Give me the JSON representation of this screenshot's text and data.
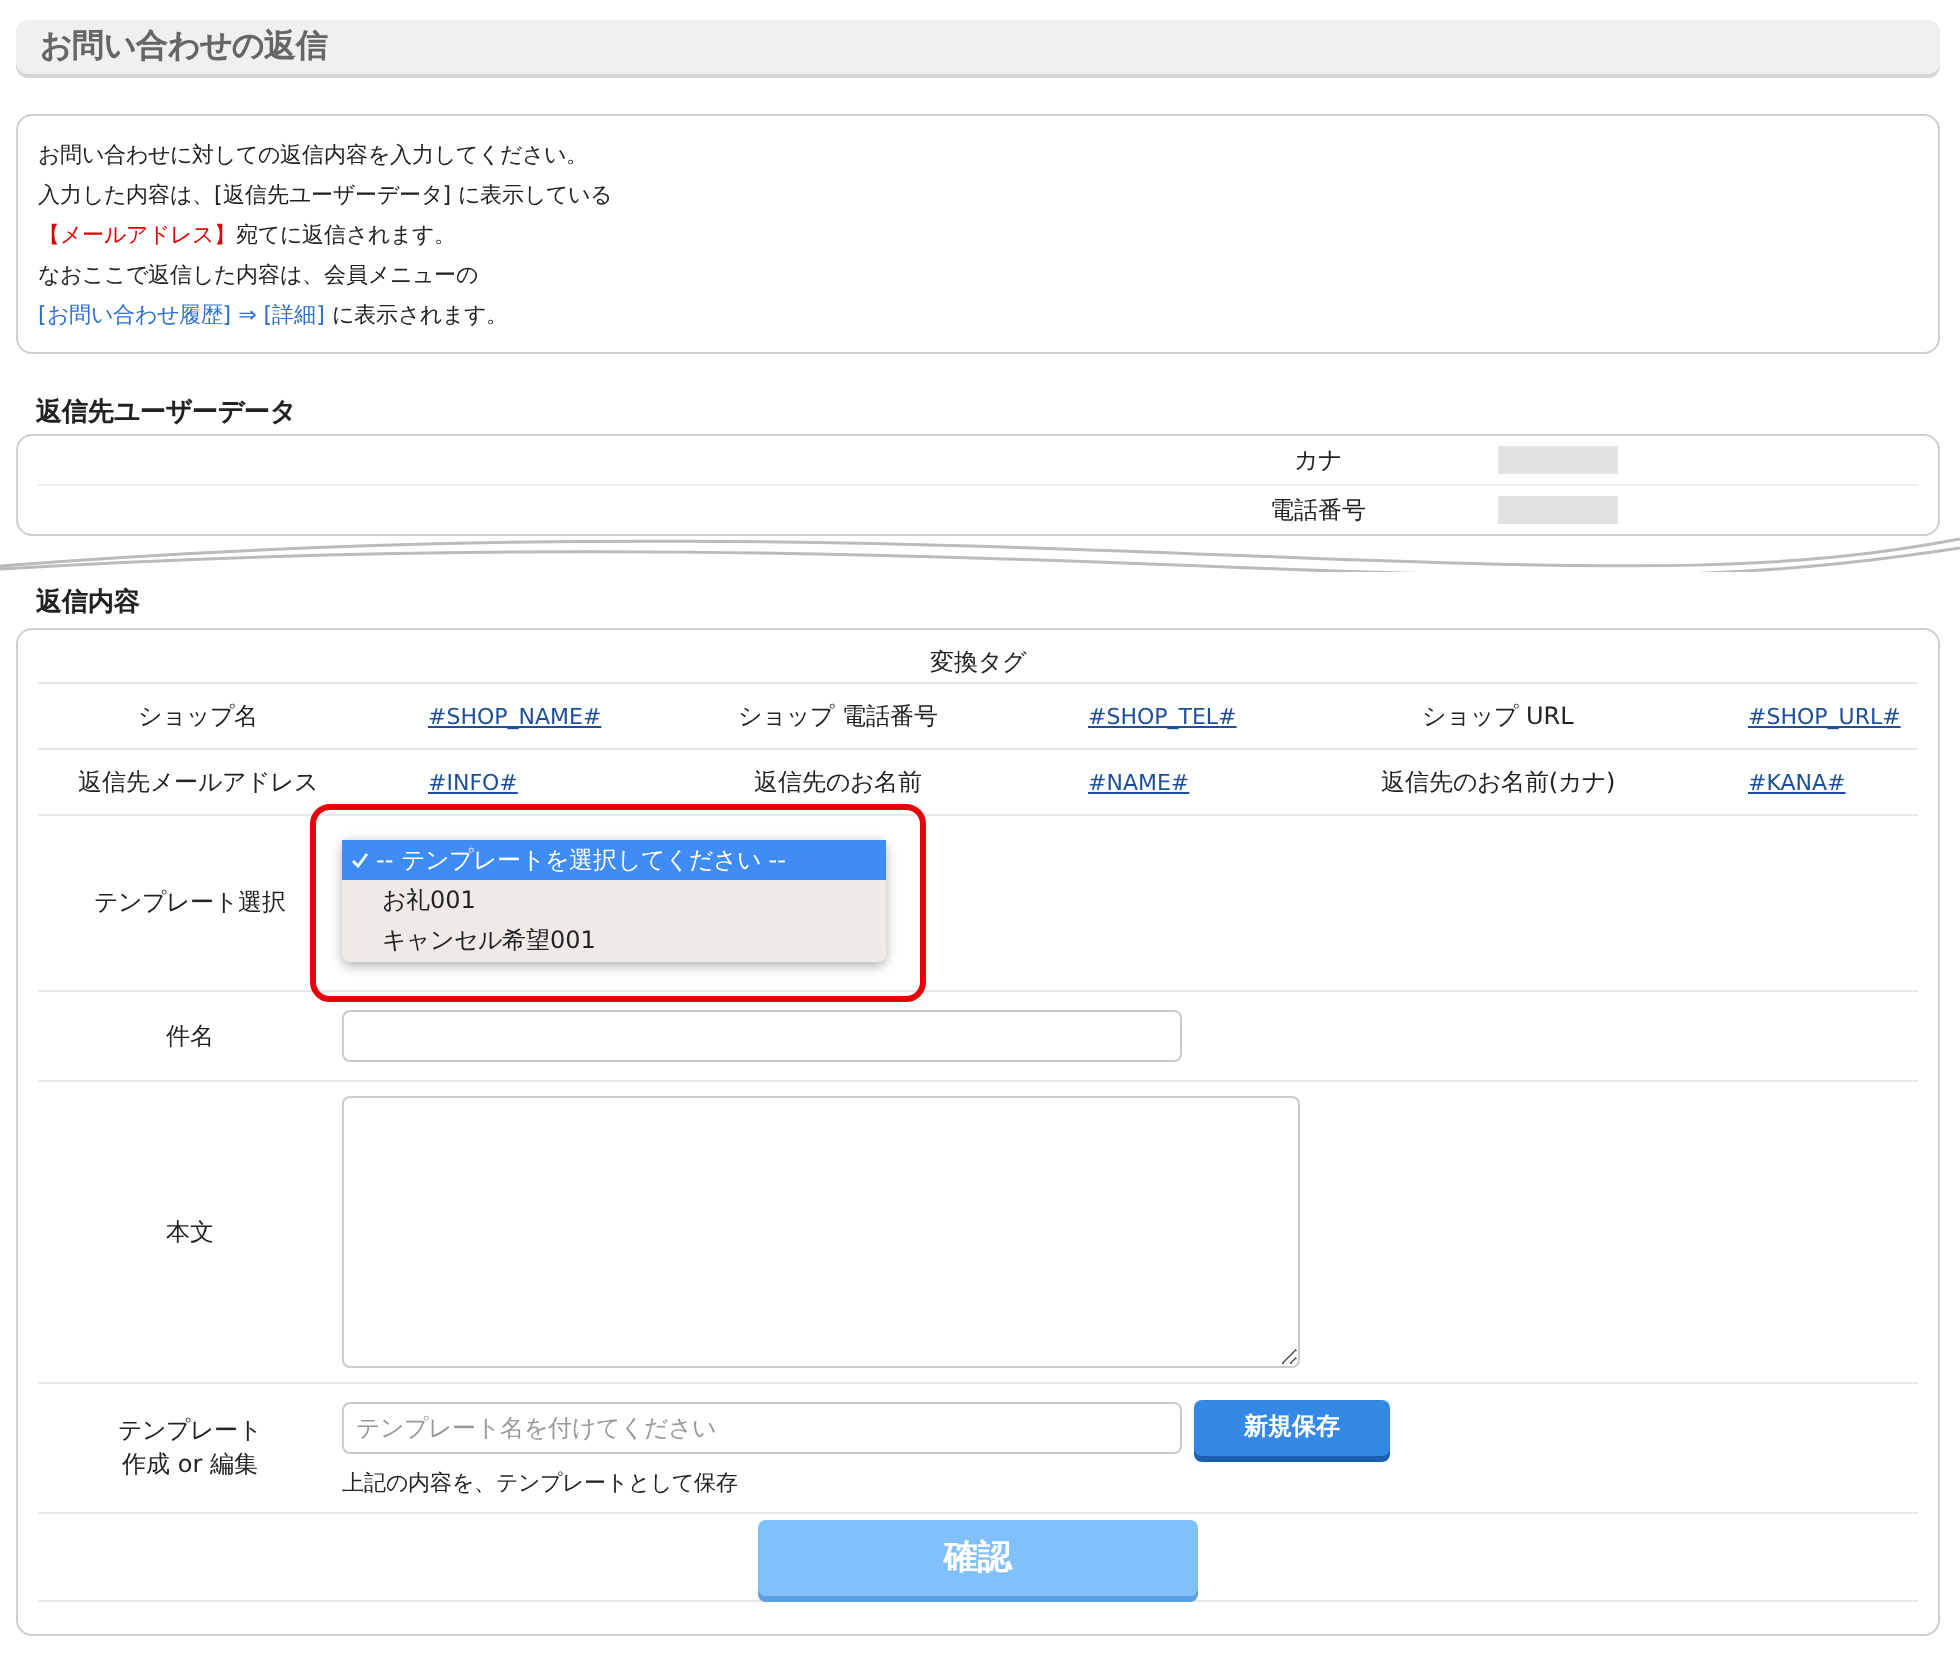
{
  "page_title": "お問い合わせの返信",
  "notice": {
    "lines": [
      [
        {
          "kind": "text",
          "text": "お問い合わせに対しての返信内容を入力してください。"
        }
      ],
      [
        {
          "kind": "text",
          "text": "入力した内容は、[返信先ユーザーデータ] に表示している"
        }
      ],
      [
        {
          "kind": "alert",
          "text": "【メールアドレス】"
        },
        {
          "kind": "text",
          "text": "宛てに返信されます。"
        }
      ],
      [
        {
          "kind": "text",
          "text": "なおここで返信した内容は、会員メニューの"
        }
      ],
      [
        {
          "kind": "link",
          "text": "[お問い合わせ履歴] ⇒ [詳細]"
        },
        {
          "kind": "text",
          "text": " に表示されます。"
        }
      ]
    ]
  },
  "user_data": {
    "heading": "返信先ユーザーデータ",
    "rows": [
      {
        "label": "カナ"
      },
      {
        "label": "電話番号"
      }
    ]
  },
  "reply": {
    "heading": "返信内容",
    "tags": {
      "title": "変換タグ",
      "rows": [
        [
          {
            "label": "ショップ名",
            "tag": "#SHOP_NAME#"
          },
          {
            "label": "ショップ 電話番号",
            "tag": "#SHOP_TEL#"
          },
          {
            "label": "ショップ URL",
            "tag": "#SHOP_URL#"
          }
        ],
        [
          {
            "label": "返信先メールアドレス",
            "tag": "#INFO#"
          },
          {
            "label": "返信先のお名前",
            "tag": "#NAME#"
          },
          {
            "label": "返信先のお名前(カナ)",
            "tag": "#KANA#"
          }
        ]
      ]
    },
    "template_select": {
      "label": "テンプレート選択",
      "expanded": true,
      "highlighted": true,
      "options": [
        {
          "label": "-- テンプレートを選択してください --",
          "selected": true
        },
        {
          "label": "お礼001",
          "selected": false
        },
        {
          "label": "キャンセル希望001",
          "selected": false
        }
      ]
    },
    "subject": {
      "label": "件名"
    },
    "body": {
      "label": "本文"
    },
    "template_save": {
      "label_lines": [
        "テンプレート",
        "作成 or 編集"
      ],
      "placeholder": "テンプレート名を付けてください",
      "button": "新規保存",
      "note": "上記の内容を、テンプレートとして保存"
    },
    "confirm": {
      "label": "確認",
      "disabled": true
    }
  }
}
